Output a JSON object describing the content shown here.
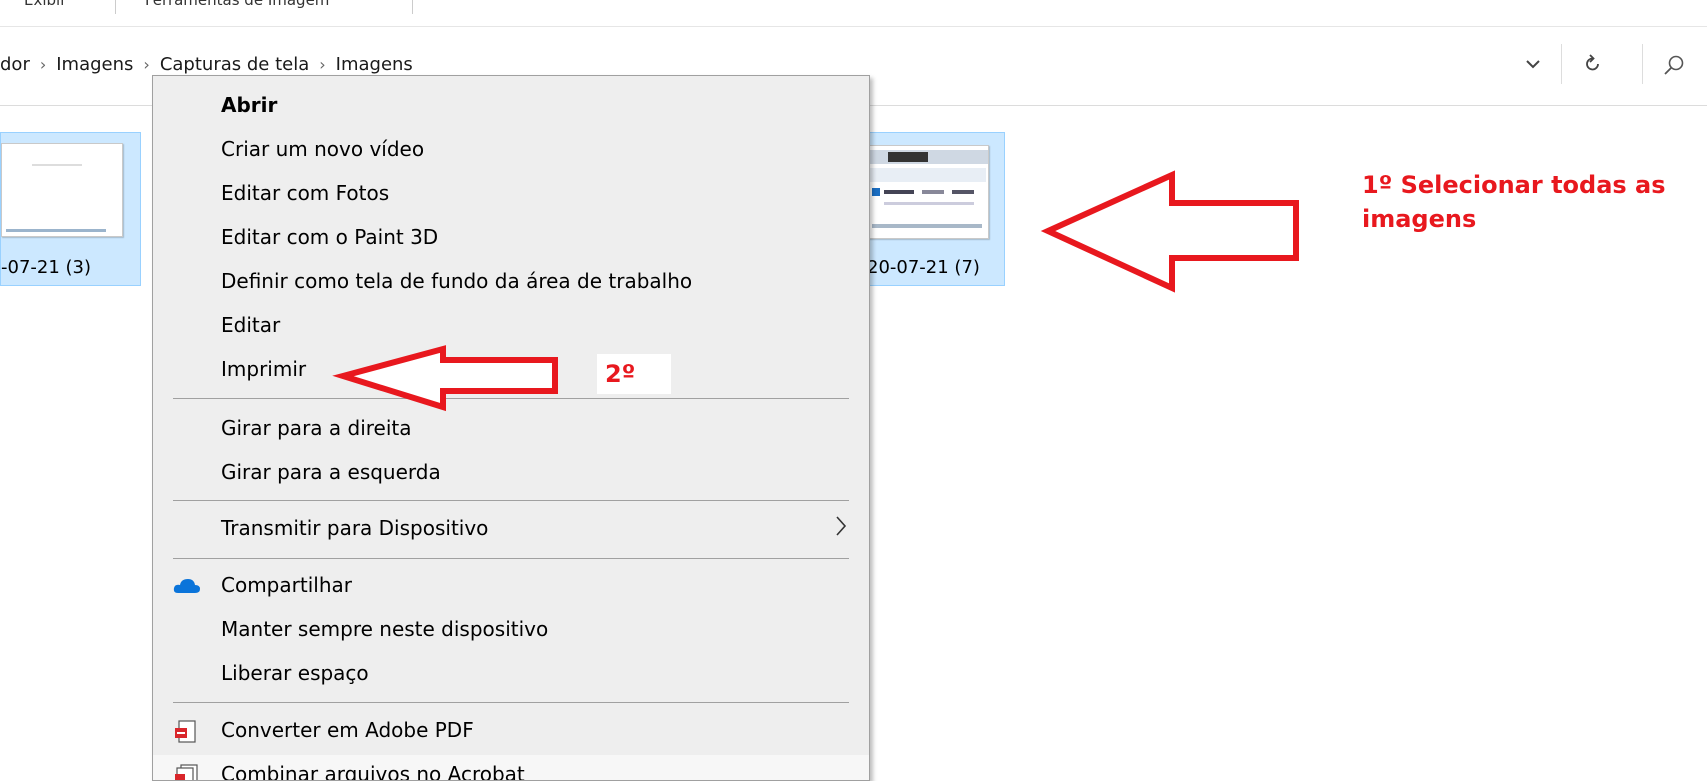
{
  "ribbon": {
    "tab_view": "Exibir",
    "tab_tools": "Ferramentas de Imagem"
  },
  "address_bar": {
    "crumbs": [
      "dor",
      "Imagens",
      "Capturas de tela",
      "Imagens"
    ],
    "separator": "›"
  },
  "files": [
    {
      "label": "-07-21 (3)"
    },
    {
      "label": "20-07-21 (7)"
    }
  ],
  "context_menu": {
    "items": [
      {
        "label": "Abrir",
        "bold": true
      },
      {
        "label": "Criar um novo vídeo"
      },
      {
        "label": "Editar com Fotos"
      },
      {
        "label": "Editar com o Paint 3D"
      },
      {
        "label": "Definir como tela de fundo da área de trabalho"
      },
      {
        "label": "Editar"
      },
      {
        "label": "Imprimir"
      },
      {
        "label": "Girar para a direita"
      },
      {
        "label": "Girar para a esquerda"
      },
      {
        "label": "Transmitir para Dispositivo",
        "submenu": true
      },
      {
        "label": "Compartilhar",
        "icon": "onedrive-cloud-icon"
      },
      {
        "label": "Manter sempre neste dispositivo"
      },
      {
        "label": "Liberar espaço"
      },
      {
        "label": "Converter em Adobe PDF",
        "icon": "adobe-pdf-icon"
      },
      {
        "label": "Combinar arquivos no Acrobat",
        "icon": "acrobat-combine-icon"
      }
    ]
  },
  "annotations": {
    "step1": [
      "1º Selecionar todas as",
      "imagens"
    ],
    "step2": "2º"
  },
  "colors": {
    "annotation_red": "#e8181e",
    "selection_blue": "#cce8ff",
    "onedrive_blue": "#0a74da"
  }
}
